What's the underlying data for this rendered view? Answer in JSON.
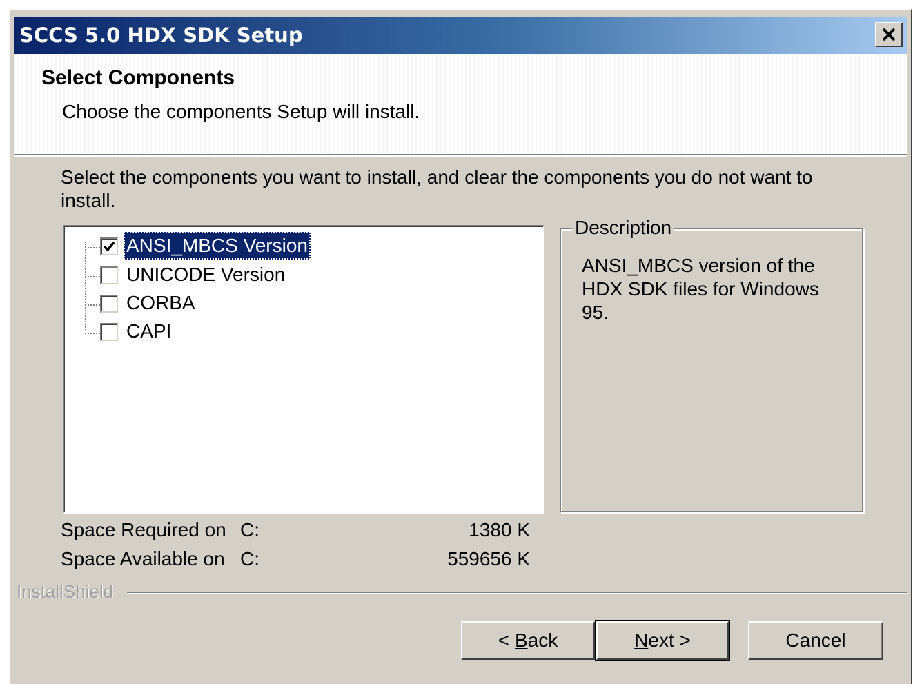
{
  "window": {
    "title": "SCCS 5.0 HDX SDK Setup",
    "close_icon": "close-x-icon"
  },
  "header": {
    "title": "Select Components",
    "subtitle": "Choose the components Setup will install."
  },
  "instructions": "Select the components you want to install, and clear the components you do not want to install.",
  "components": [
    {
      "label": "ANSI_MBCS Version",
      "checked": true,
      "selected": true
    },
    {
      "label": "UNICODE Version",
      "checked": false,
      "selected": false
    },
    {
      "label": "CORBA",
      "checked": false,
      "selected": false
    },
    {
      "label": "CAPI",
      "checked": false,
      "selected": false
    }
  ],
  "description": {
    "legend": "Description",
    "text": "ANSI_MBCS version of the HDX SDK files for Windows 95."
  },
  "space": {
    "required_label": "Space Required on",
    "required_drive": "C:",
    "required_value": "1380 K",
    "available_label": "Space Available on",
    "available_drive": "C:",
    "available_value": "559656 K"
  },
  "brand": "InstallShield",
  "buttons": {
    "back": {
      "prefix": "< ",
      "mnemonic": "B",
      "rest": "ack"
    },
    "next": {
      "mnemonic": "N",
      "rest": "ext >"
    },
    "cancel": "Cancel"
  }
}
